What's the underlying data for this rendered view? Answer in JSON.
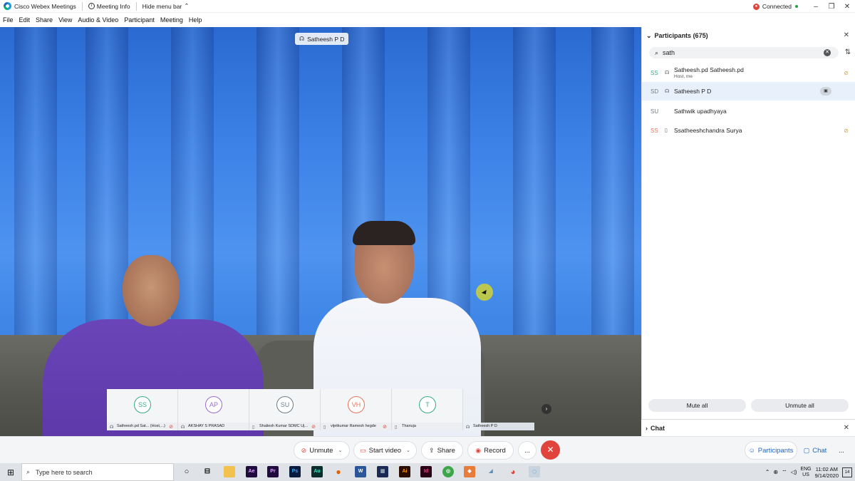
{
  "titlebar": {
    "app_name": "Cisco Webex Meetings",
    "meeting_info": "Meeting Info",
    "hide_menu": "Hide menu bar",
    "status": "Connected"
  },
  "menu": [
    "File",
    "Edit",
    "Share",
    "View",
    "Audio & Video",
    "Participant",
    "Meeting",
    "Help"
  ],
  "video": {
    "active_speaker": "Satheesh P D"
  },
  "thumbnails": [
    {
      "initials": "SS",
      "name": "Satheesh.pd Sat... (Host,...)",
      "color": "#3aa88a"
    },
    {
      "initials": "AP",
      "name": "AKSHAY S PRASAD",
      "color": "#9b6ad0"
    },
    {
      "initials": "SU",
      "name": "Shaliesh Kumar SDMC Uj...",
      "color": "#6d7d8c"
    },
    {
      "initials": "VH",
      "name": "vijetkumar Ramesh hegde",
      "color": "#e3735b"
    },
    {
      "initials": "T",
      "name": "Thanuja",
      "color": "#3aa88a"
    },
    {
      "initials": "",
      "name": "Satheesh P D",
      "color": ""
    }
  ],
  "participants_panel": {
    "title": "Participants (675)",
    "search_value": "sath",
    "items": [
      {
        "initials": "SS",
        "name": "Satheesh.pd Satheesh.pd",
        "sub": "Host, me"
      },
      {
        "initials": "SD",
        "name": "Satheesh P D",
        "sub": ""
      },
      {
        "initials": "SU",
        "name": "Sathwik upadhyaya",
        "sub": ""
      },
      {
        "initials": "SS",
        "name": "Ssatheeshchandra Surya",
        "sub": ""
      }
    ],
    "mute_all": "Mute all",
    "unmute_all": "Unmute all",
    "chat_label": "Chat"
  },
  "controls": {
    "unmute": "Unmute",
    "start_video": "Start video",
    "share": "Share",
    "record": "Record",
    "more": "...",
    "participants": "Participants",
    "chat": "Chat"
  },
  "taskbar": {
    "search_placeholder": "Type here to search",
    "lang_top": "ENG",
    "lang_bottom": "US",
    "time": "11:02 AM",
    "date": "9/14/2020",
    "notifications": "14"
  },
  "colors": {
    "accent_blue": "#2066c4",
    "end_red": "#e0443c",
    "panel_selected": "#e8f1fb"
  }
}
